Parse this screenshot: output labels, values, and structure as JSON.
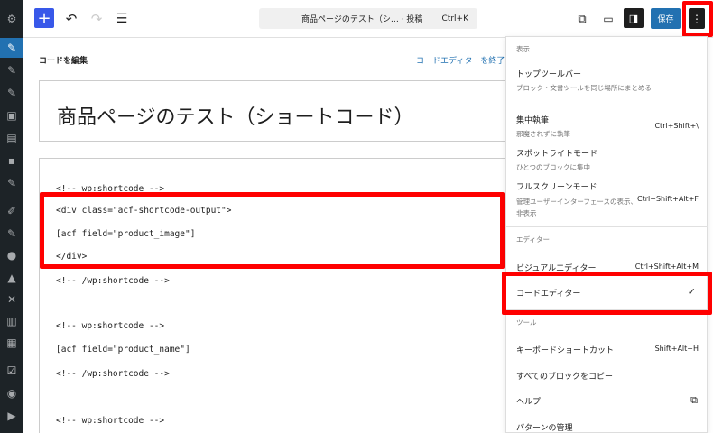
{
  "sidebar": {
    "icons": [
      "gear-icon",
      "pin-icon",
      "pin-icon",
      "pin-icon",
      "media-icon",
      "pages-icon",
      "comments-icon",
      "pin-icon",
      "tools-icon",
      "brush-icon",
      "plugins-icon",
      "users-icon",
      "lock-icon",
      "wrench-icon",
      "import-icon",
      "grid-icon",
      "check-icon",
      "eye-icon",
      "play-icon"
    ]
  },
  "toolbar": {
    "add_glyph": "+",
    "undo_glyph": "↶",
    "redo_glyph": "↷",
    "list_glyph": "☰",
    "command_title": "商品ページのテスト（シ…",
    "command_type": "· 投稿",
    "command_shortcut": "Ctrl+K",
    "external_glyph": "⧉",
    "preview_glyph": "▭",
    "settings_glyph": "◨",
    "save_label": "保存",
    "more_glyph": "⋮"
  },
  "editor": {
    "heading": "コードを編集",
    "exit_link": "コードエディターを終了",
    "post_title": "商品ページのテスト（ショートコード）",
    "code_lines": [
      "<!-- wp:shortcode -->",
      "<div class=\"acf-shortcode-output\">",
      "[acf field=\"product_image\"]",
      "</div>",
      "<!-- /wp:shortcode -->",
      "<!-- wp:shortcode -->",
      "[acf field=\"product_name\"]",
      "<!-- /wp:shortcode -->",
      "<!-- wp:shortcode -->"
    ]
  },
  "menu": {
    "group_view": "表示",
    "top_toolbar_label": "トップツールバー",
    "top_toolbar_desc": "ブロック・文書ツールを同じ場所にまとめる",
    "focus_label": "集中執筆",
    "focus_desc": "邪魔されずに執筆",
    "focus_shortcut": "Ctrl+Shift+\\",
    "spotlight_label": "スポットライトモード",
    "spotlight_desc": "ひとつのブロックに集中",
    "fullscreen_label": "フルスクリーンモード",
    "fullscreen_desc": "管理ユーザーインターフェースの表示、非表示",
    "fullscreen_shortcut": "Ctrl+Shift+Alt+F",
    "group_editor": "エディター",
    "visual_label": "ビジュアルエディター",
    "visual_shortcut": "Ctrl+Shift+Alt+M",
    "code_label": "コードエディター",
    "code_check": "✓",
    "group_tools": "ツール",
    "keyboard_label": "キーボードショートカット",
    "keyboard_shortcut": "Shift+Alt+H",
    "copy_label": "すべてのブロックをコピー",
    "help_label": "ヘルプ",
    "help_ext_glyph": "⧉",
    "patterns_label": "パターンの管理"
  },
  "colors": {
    "accent": "#2271b1",
    "highlight": "#ff0000",
    "sidebar_bg": "#1d2327"
  }
}
